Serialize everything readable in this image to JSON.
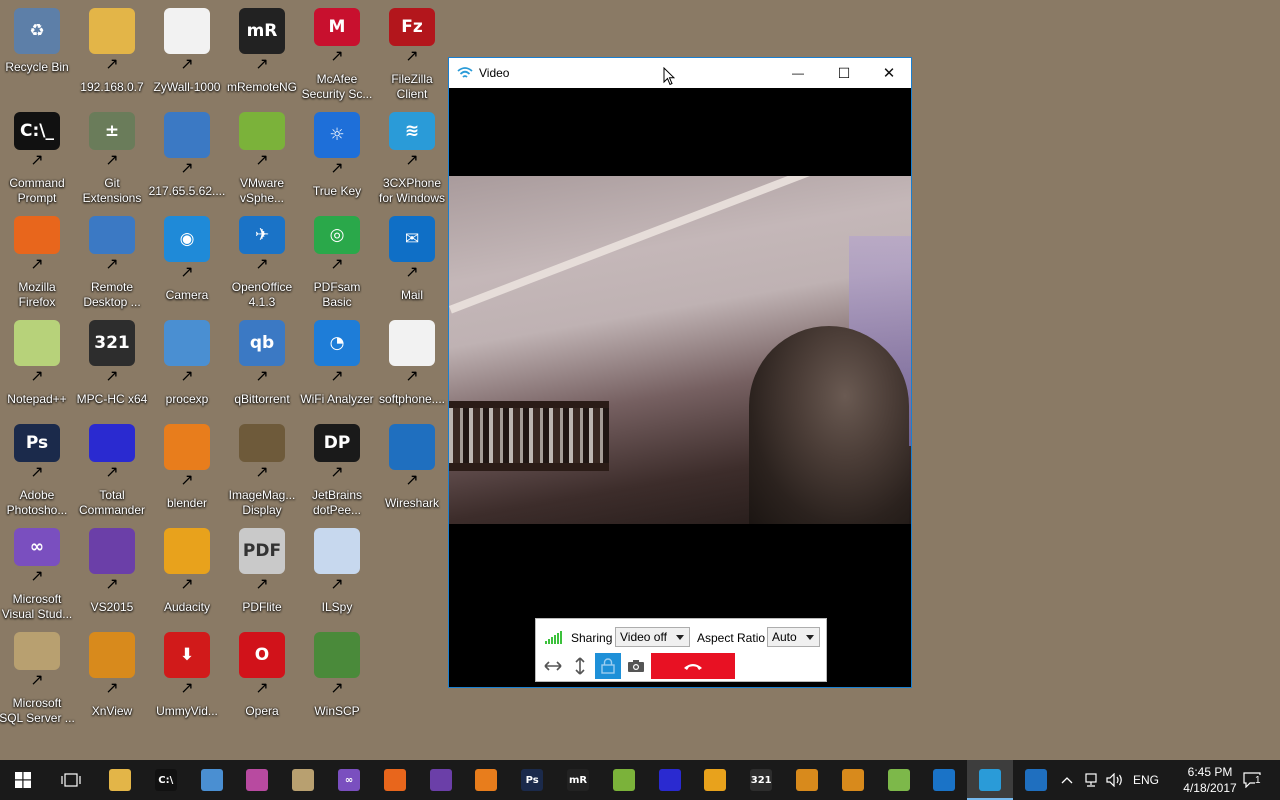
{
  "desktop": {
    "icons": [
      {
        "label": "Recycle Bin",
        "color": "#5d7fa8",
        "glyph": "♻",
        "shortcut": false
      },
      {
        "label": "192.168.0.7",
        "color": "#e3b548",
        "glyph": "",
        "shortcut": true
      },
      {
        "label": "ZyWall-1000",
        "color": "#f2f2f2",
        "glyph": "",
        "shortcut": true
      },
      {
        "label": "mRemoteNG",
        "color": "#222222",
        "glyph": "mR",
        "shortcut": true
      },
      {
        "label": "McAfee\nSecurity Sc...",
        "color": "#c8102e",
        "glyph": "M",
        "shortcut": true
      },
      {
        "label": "FileZilla\nClient",
        "color": "#b3161c",
        "glyph": "Fz",
        "shortcut": true
      },
      {
        "label": "Command\nPrompt",
        "color": "#111111",
        "glyph": "C:\\_",
        "shortcut": true
      },
      {
        "label": "Git\nExtensions",
        "color": "#6a7c5a",
        "glyph": "±",
        "shortcut": true
      },
      {
        "label": "217.65.5.62....",
        "color": "#3b79c4",
        "glyph": "",
        "shortcut": true
      },
      {
        "label": "VMware\nvSphe...",
        "color": "#7bb23a",
        "glyph": "",
        "shortcut": true
      },
      {
        "label": "True Key",
        "color": "#1e6fd9",
        "glyph": "☼",
        "shortcut": true
      },
      {
        "label": "3CXPhone\nfor Windows",
        "color": "#2a9bd8",
        "glyph": "≋",
        "shortcut": true
      },
      {
        "label": "Mozilla\nFirefox",
        "color": "#e8661c",
        "glyph": "",
        "shortcut": true
      },
      {
        "label": "Remote\nDesktop ...",
        "color": "#3b79c4",
        "glyph": "",
        "shortcut": true
      },
      {
        "label": "Camera",
        "color": "#1f8ad8",
        "glyph": "◉",
        "shortcut": true
      },
      {
        "label": "OpenOffice\n4.1.3",
        "color": "#1a73c7",
        "glyph": "✈",
        "shortcut": true
      },
      {
        "label": "PDFsam\nBasic",
        "color": "#2aa84a",
        "glyph": "◎",
        "shortcut": true
      },
      {
        "label": "Mail",
        "color": "#0f6fc6",
        "glyph": "✉",
        "shortcut": true
      },
      {
        "label": "Notepad++",
        "color": "#b7d27a",
        "glyph": "",
        "shortcut": true
      },
      {
        "label": "MPC-HC x64",
        "color": "#2d2d2d",
        "glyph": "321",
        "shortcut": true
      },
      {
        "label": "procexp",
        "color": "#4a8fd2",
        "glyph": "",
        "shortcut": true
      },
      {
        "label": "qBittorrent",
        "color": "#3b79c4",
        "glyph": "qb",
        "shortcut": true
      },
      {
        "label": "WiFi Analyzer",
        "color": "#1e7dd8",
        "glyph": "◔",
        "shortcut": true
      },
      {
        "label": "softphone....",
        "color": "#f2f2f2",
        "glyph": "",
        "shortcut": true
      },
      {
        "label": "Adobe\nPhotosho...",
        "color": "#1b2a4b",
        "glyph": "Ps",
        "shortcut": true
      },
      {
        "label": "Total\nCommander",
        "color": "#2a2ad0",
        "glyph": "",
        "shortcut": true
      },
      {
        "label": "blender",
        "color": "#e87d1c",
        "glyph": "",
        "shortcut": true
      },
      {
        "label": "ImageMag...\nDisplay",
        "color": "#6e5a3a",
        "glyph": "",
        "shortcut": true
      },
      {
        "label": "JetBrains\ndotPee...",
        "color": "#1a1a1a",
        "glyph": "DP",
        "shortcut": true
      },
      {
        "label": "Wireshark",
        "color": "#1f6fbf",
        "glyph": "",
        "shortcut": true
      },
      {
        "label": "Microsoft\nVisual Stud...",
        "color": "#7a4fbf",
        "glyph": "∞",
        "shortcut": true
      },
      {
        "label": "VS2015",
        "color": "#6b3fa8",
        "glyph": "",
        "shortcut": true
      },
      {
        "label": "Audacity",
        "color": "#e8a21c",
        "glyph": "",
        "shortcut": true
      },
      {
        "label": "PDFlite",
        "color": "#c9c9c9",
        "glyph": "PDF",
        "shortcut": true
      },
      {
        "label": "ILSpy",
        "color": "#c7d8ee",
        "glyph": "",
        "shortcut": true
      },
      {
        "label": "",
        "color": "",
        "glyph": "",
        "shortcut": false
      },
      {
        "label": "Microsoft\nSQL Server ...",
        "color": "#b8a070",
        "glyph": "",
        "shortcut": true
      },
      {
        "label": "XnView",
        "color": "#d88a1c",
        "glyph": "",
        "shortcut": true
      },
      {
        "label": "UmmyVid...",
        "color": "#d11a1a",
        "glyph": "⬇",
        "shortcut": true
      },
      {
        "label": "Opera",
        "color": "#d1121a",
        "glyph": "O",
        "shortcut": true
      },
      {
        "label": "WinSCP",
        "color": "#4a8a3a",
        "glyph": "",
        "shortcut": true
      }
    ]
  },
  "window": {
    "title": "Video",
    "minimize_glyph": "—",
    "maximize_glyph": "☐",
    "close_glyph": "✕"
  },
  "controls": {
    "sharing_label": "Sharing",
    "sharing_value": "Video off",
    "aspect_label": "Aspect Ratio",
    "aspect_value": "Auto",
    "hangup_color": "#e81123"
  },
  "taskbar": {
    "apps": [
      {
        "name": "file-explorer",
        "color": "#e3b548",
        "glyph": ""
      },
      {
        "name": "command-prompt",
        "color": "#111111",
        "glyph": "C:\\"
      },
      {
        "name": "procexp",
        "color": "#4a8fd2",
        "glyph": ""
      },
      {
        "name": "app-puzzle",
        "color": "#b84aa0",
        "glyph": ""
      },
      {
        "name": "sql-server",
        "color": "#b8a070",
        "glyph": ""
      },
      {
        "name": "visual-studio-infinity",
        "color": "#7a4fbf",
        "glyph": "∞"
      },
      {
        "name": "firefox",
        "color": "#e8661c",
        "glyph": ""
      },
      {
        "name": "vs2015",
        "color": "#6b3fa8",
        "glyph": ""
      },
      {
        "name": "blender",
        "color": "#e87d1c",
        "glyph": ""
      },
      {
        "name": "photoshop",
        "color": "#1b2a4b",
        "glyph": "Ps"
      },
      {
        "name": "mremoteng",
        "color": "#222222",
        "glyph": "mR"
      },
      {
        "name": "vmware",
        "color": "#7bb23a",
        "glyph": ""
      },
      {
        "name": "total-commander",
        "color": "#2a2ad0",
        "glyph": ""
      },
      {
        "name": "audacity",
        "color": "#e8a21c",
        "glyph": ""
      },
      {
        "name": "mpc-hc",
        "color": "#2d2d2d",
        "glyph": "321"
      },
      {
        "name": "xnview-1",
        "color": "#d88a1c",
        "glyph": ""
      },
      {
        "name": "xnview-2",
        "color": "#d88a1c",
        "glyph": ""
      },
      {
        "name": "notepad-plus",
        "color": "#7db84a",
        "glyph": ""
      },
      {
        "name": "openoffice",
        "color": "#1a73c7",
        "glyph": ""
      },
      {
        "name": "3cxphone",
        "color": "#2a9bd8",
        "glyph": ""
      },
      {
        "name": "wireshark",
        "color": "#1f6fbf",
        "glyph": ""
      }
    ],
    "active_index": 19,
    "language": "ENG",
    "time": "6:45 PM",
    "date": "4/18/2017",
    "notification_count": "1"
  }
}
